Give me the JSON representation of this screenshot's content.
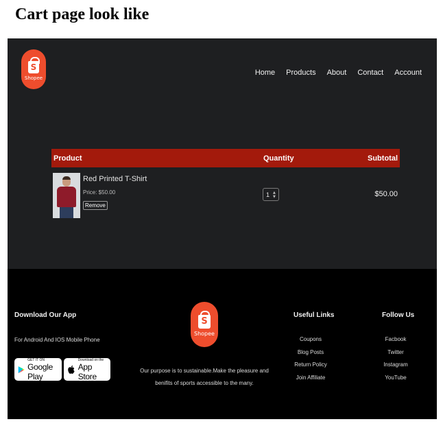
{
  "page_heading": "Cart page look like",
  "brand": {
    "logo_letter": "S",
    "logo_text": "Shopee",
    "accent": "#ee4d2d"
  },
  "nav": {
    "items": [
      {
        "label": "Home"
      },
      {
        "label": "Products"
      },
      {
        "label": "About"
      },
      {
        "label": "Contact"
      },
      {
        "label": "Account"
      }
    ]
  },
  "cart": {
    "header_color": "#a31a0c",
    "columns": {
      "product": "Product",
      "quantity": "Quantity",
      "subtotal": "Subtotal"
    },
    "items": [
      {
        "name": "Red Printed T-Shirt",
        "price": "Price: $50.00",
        "remove_label": "Remove",
        "quantity": "1",
        "subtotal": "$50.00",
        "image_icon": "tshirt-model-image"
      }
    ]
  },
  "footer": {
    "app": {
      "title": "Download Our App",
      "subtitle": "For Android And IOS Mobile Phone",
      "google_play": {
        "small": "GET IT ON",
        "big": "Google Play"
      },
      "app_store": {
        "small": "Download on the",
        "big": "App Store"
      }
    },
    "about": "Our purpose is to sustainable.Make the pleasure and benifits of sports accessible to the many.",
    "useful_links": {
      "title": "Useful Links",
      "items": [
        "Coupons",
        "Blog Posts",
        "Return Policy",
        "Join Affiliate"
      ]
    },
    "follow_us": {
      "title": "Follow Us",
      "items": [
        "Facbook",
        "Twitter",
        "Instagram",
        "YouTube"
      ]
    }
  }
}
